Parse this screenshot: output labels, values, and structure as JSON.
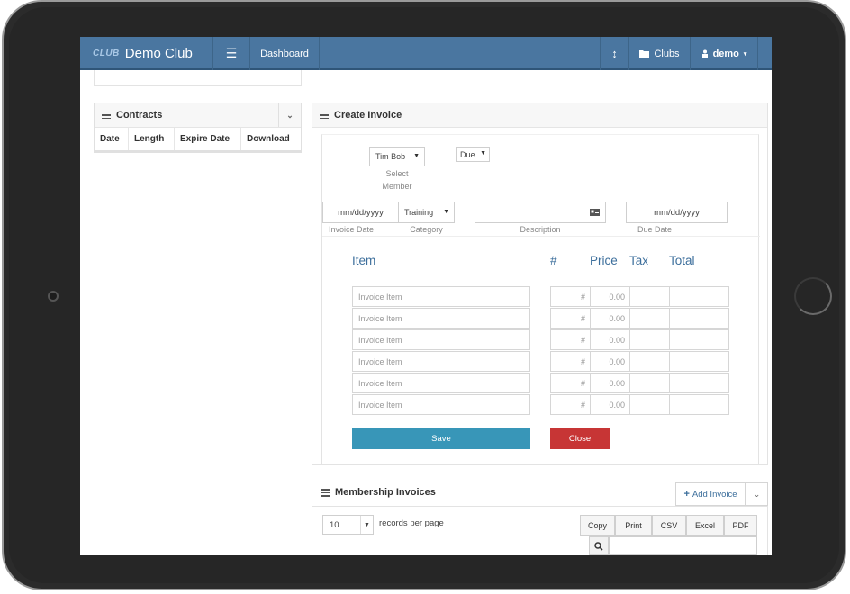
{
  "nav": {
    "logo_text": "CLUB",
    "brand_name": "Demo Club",
    "dashboard_label": "Dashboard",
    "clubs_label": "Clubs",
    "user_label": "demo",
    "accent_color": "#4a76a0"
  },
  "contracts": {
    "title": "Contracts",
    "columns": [
      "Date",
      "Length",
      "Expire Date",
      "Download"
    ]
  },
  "create_invoice": {
    "title": "Create Invoice",
    "member_value": "Tim Bob",
    "member_label_1": "Select",
    "member_label_2": "Member",
    "status_value": "Due",
    "invoice_date_placeholder": "mm/dd/yyyy",
    "invoice_date_label": "Invoice Date",
    "category_value": "Training",
    "category_label": "Category",
    "description_label": "Description",
    "due_date_placeholder": "mm/dd/yyyy",
    "due_date_label": "Due Date",
    "headers": {
      "item": "Item",
      "qty": "#",
      "price": "Price",
      "tax": "Tax",
      "total": "Total"
    },
    "rows": [
      {
        "item": "Invoice Item",
        "qty": "#",
        "price": "0.00"
      },
      {
        "item": "Invoice Item",
        "qty": "#",
        "price": "0.00"
      },
      {
        "item": "Invoice Item",
        "qty": "#",
        "price": "0.00"
      },
      {
        "item": "Invoice Item",
        "qty": "#",
        "price": "0.00"
      },
      {
        "item": "Invoice Item",
        "qty": "#",
        "price": "0.00"
      },
      {
        "item": "Invoice Item",
        "qty": "#",
        "price": "0.00"
      }
    ],
    "save_label": "Save",
    "close_label": "Close",
    "save_color": "#3896b8",
    "close_color": "#c73535"
  },
  "membership_invoices": {
    "title": "Membership Invoices",
    "add_label": "Add Invoice",
    "records_value": "10",
    "records_label": "records per page",
    "export_buttons": [
      "Copy",
      "Print",
      "CSV",
      "Excel",
      "PDF"
    ]
  }
}
